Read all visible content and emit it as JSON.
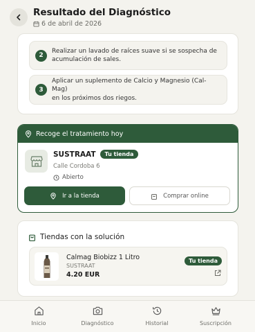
{
  "header": {
    "title": "Resultado del Diagnóstico",
    "date": "6 de abril de 2026"
  },
  "steps": [
    {
      "number": "2",
      "text_line1": "Realizar un lavado de raíces suave si se sospecha de",
      "text_line2": "acumulación de sales."
    },
    {
      "number": "3",
      "text_line1": "Aplicar un suplemento de Calcio y Magnesio (Cal-Mag)",
      "text_line2": "en los próximos dos riegos."
    }
  ],
  "pickup": {
    "heading": "Recoge el tratamiento hoy",
    "store_name": "SUSTRAAT",
    "badge": "Tu tienda",
    "address": "Calle Cordoba 6",
    "status": "Abierto",
    "go_button": "Ir a la tienda",
    "online_button": "Comprar online"
  },
  "solution": {
    "heading": "Tiendas con la solución",
    "product": {
      "name": "Calmag Biobizz 1 Litro",
      "shop": "SUSTRAAT",
      "price": "4.20 EUR",
      "badge": "Tu tienda"
    }
  },
  "tabs": [
    {
      "label": "Inicio",
      "icon": "home-icon"
    },
    {
      "label": "Diagnóstico",
      "icon": "camera-icon"
    },
    {
      "label": "Historial",
      "icon": "history-icon"
    },
    {
      "label": "Suscripción",
      "icon": "crown-icon"
    }
  ],
  "colors": {
    "accent": "#2e5b3a",
    "background": "#f4f3ee"
  }
}
